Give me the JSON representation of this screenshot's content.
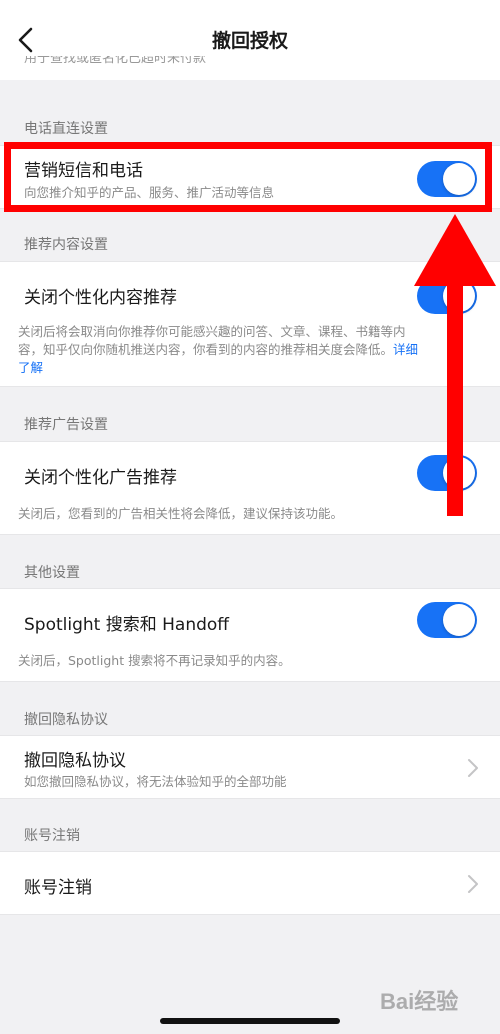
{
  "header": {
    "title": "撤回授权",
    "partial_text": "用于查找或匿名化已超时未付款"
  },
  "sections": {
    "phone": {
      "label": "电话直连设置",
      "row_title": "营销短信和电话",
      "row_subtitle": "向您推介知乎的产品、服务、推广活动等信息",
      "toggle_on": true
    },
    "content": {
      "label": "推荐内容设置",
      "row_title": "关闭个性化内容推荐",
      "desc_line1": "关闭后将会取消向你推荐你可能感兴趣的问答、文章、课程、书籍等内",
      "desc_line2": "容，知乎仅向你随机推送内容，你看到的内容的推荐相关度会降低。",
      "desc_link_part1": "详细",
      "desc_link_part2": "了解",
      "toggle_on": true
    },
    "ads": {
      "label": "推荐广告设置",
      "row_title": "关闭个性化广告推荐",
      "desc": "关闭后，您看到的广告相关性将会降低，建议保持该功能。",
      "toggle_on": true
    },
    "other": {
      "label": "其他设置",
      "row_title": "Spotlight 搜索和 Handoff",
      "desc": "关闭后，Spotlight 搜索将不再记录知乎的内容。",
      "toggle_on": true
    },
    "privacy": {
      "label": "撤回隐私协议",
      "row_title": "撤回隐私协议",
      "row_subtitle": "如您撤回隐私协议，将无法体验知乎的全部功能"
    },
    "account": {
      "label": "账号注销",
      "row_title": "账号注销"
    }
  },
  "watermark": "Bai经验",
  "colors": {
    "accent": "#1772f6",
    "annotation": "#ff0000"
  }
}
